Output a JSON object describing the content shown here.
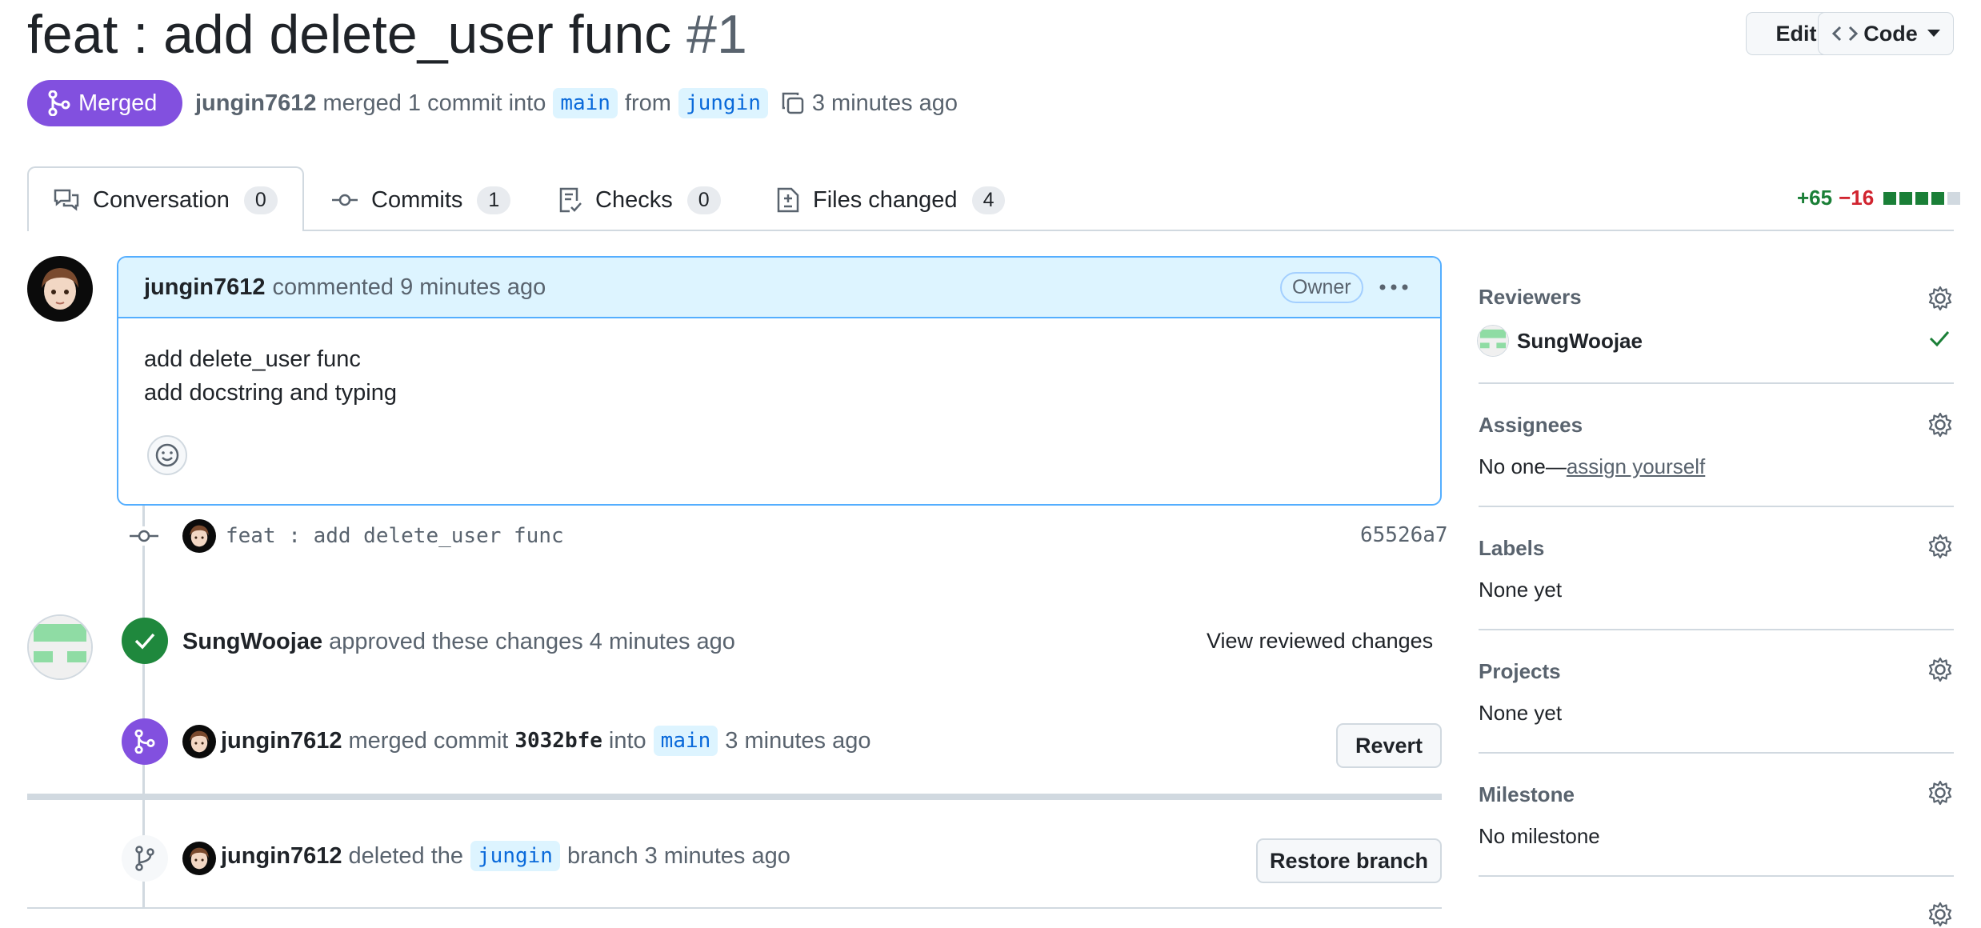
{
  "header": {
    "title": "feat : add delete_user func",
    "number": "#1",
    "edit_label": "Edit",
    "code_label": "Code"
  },
  "status": {
    "badge": "Merged",
    "author": "jungin7612",
    "text_merged": "merged 1 commit into",
    "base_branch": "main",
    "text_from": "from",
    "head_branch": "jungin",
    "time": "3 minutes ago"
  },
  "tabs": [
    {
      "label": "Conversation",
      "count": "0"
    },
    {
      "label": "Commits",
      "count": "1"
    },
    {
      "label": "Checks",
      "count": "0"
    },
    {
      "label": "Files changed",
      "count": "4"
    }
  ],
  "diffstat": {
    "additions": "+65",
    "deletions": "−16",
    "colors": [
      "#1a7f37",
      "#1a7f37",
      "#1a7f37",
      "#1a7f37",
      "#d1d9e0"
    ]
  },
  "comment": {
    "author": "jungin7612",
    "action": "commented 9 minutes ago",
    "role": "Owner",
    "lines": [
      "add delete_user func",
      "add docstring and typing"
    ]
  },
  "commit": {
    "message": "feat : add delete_user func",
    "sha": "65526a7"
  },
  "review": {
    "reviewer": "SungWoojae",
    "text": "approved these changes 4 minutes ago",
    "link": "View reviewed changes"
  },
  "merge_event": {
    "author": "jungin7612",
    "text1": "merged commit",
    "sha": "3032bfe",
    "text2": "into",
    "branch": "main",
    "time": "3 minutes ago",
    "button": "Revert"
  },
  "delete_event": {
    "author": "jungin7612",
    "text1": "deleted the",
    "branch": "jungin",
    "text2": "branch 3 minutes ago",
    "button": "Restore branch"
  },
  "sidebar": {
    "reviewers": {
      "title": "Reviewers",
      "name": "SungWoojae"
    },
    "assignees": {
      "title": "Assignees",
      "prefix": "No one—",
      "link": "assign yourself"
    },
    "labels": {
      "title": "Labels",
      "value": "None yet"
    },
    "projects": {
      "title": "Projects",
      "value": "None yet"
    },
    "milestone": {
      "title": "Milestone",
      "value": "No milestone"
    }
  }
}
